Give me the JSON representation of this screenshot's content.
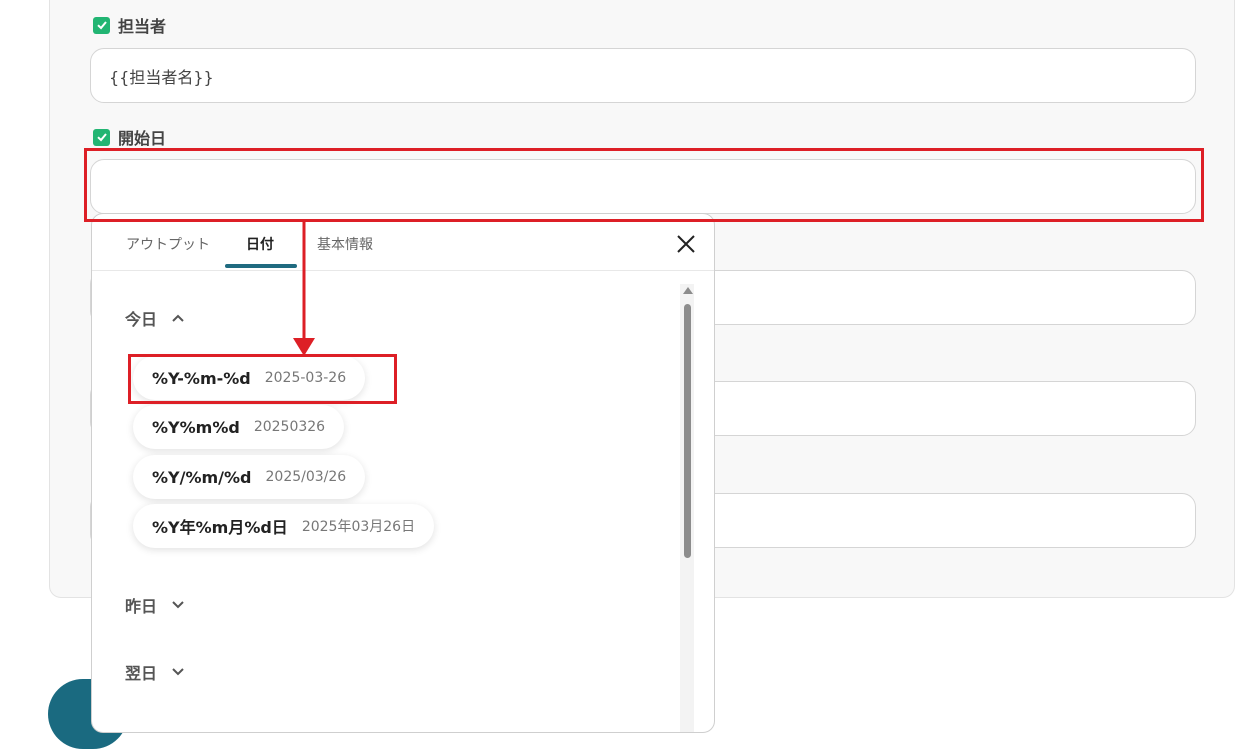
{
  "fields": [
    {
      "label": "担当者",
      "value": "{{担当者名}}"
    },
    {
      "label": "開始日",
      "value": ""
    }
  ],
  "popup": {
    "tabs": [
      "アウトプット",
      "日付",
      "基本情報"
    ],
    "active_tab": "日付",
    "sections": {
      "today": {
        "title": "今日",
        "items": [
          {
            "format": "%Y-%m-%d",
            "example": "2025-03-26"
          },
          {
            "format": "%Y%m%d",
            "example": "20250326"
          },
          {
            "format": "%Y/%m/%d",
            "example": "2025/03/26"
          },
          {
            "format": "%Y年%m月%d日",
            "example": "2025年03月26日"
          }
        ]
      },
      "yesterday": {
        "title": "昨日"
      },
      "tomorrow": {
        "title": "翌日"
      }
    }
  },
  "colors": {
    "accent": "#1f6b80",
    "highlight": "#dd1f26",
    "checkbox": "#22b573"
  }
}
